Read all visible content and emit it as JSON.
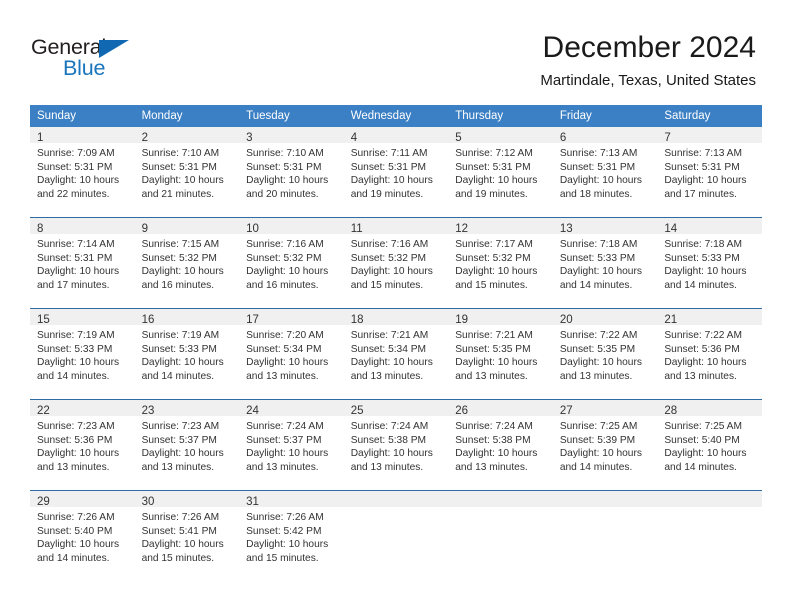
{
  "brand": {
    "name_part1": "General",
    "name_part2": "Blue",
    "accent_color": "#1b75bc",
    "triangle_color": "#1068b3"
  },
  "header": {
    "title": "December 2024",
    "subtitle": "Martindale, Texas, United States"
  },
  "calendar": {
    "header_bg": "#3b7fc4",
    "daynum_bg": "#f0f0f0",
    "separator_color": "#2e6da4",
    "weekday_headers": [
      "Sunday",
      "Monday",
      "Tuesday",
      "Wednesday",
      "Thursday",
      "Friday",
      "Saturday"
    ],
    "weeks": [
      [
        {
          "day": "1",
          "sunrise": "Sunrise: 7:09 AM",
          "sunset": "Sunset: 5:31 PM",
          "daylight1": "Daylight: 10 hours",
          "daylight2": "and 22 minutes."
        },
        {
          "day": "2",
          "sunrise": "Sunrise: 7:10 AM",
          "sunset": "Sunset: 5:31 PM",
          "daylight1": "Daylight: 10 hours",
          "daylight2": "and 21 minutes."
        },
        {
          "day": "3",
          "sunrise": "Sunrise: 7:10 AM",
          "sunset": "Sunset: 5:31 PM",
          "daylight1": "Daylight: 10 hours",
          "daylight2": "and 20 minutes."
        },
        {
          "day": "4",
          "sunrise": "Sunrise: 7:11 AM",
          "sunset": "Sunset: 5:31 PM",
          "daylight1": "Daylight: 10 hours",
          "daylight2": "and 19 minutes."
        },
        {
          "day": "5",
          "sunrise": "Sunrise: 7:12 AM",
          "sunset": "Sunset: 5:31 PM",
          "daylight1": "Daylight: 10 hours",
          "daylight2": "and 19 minutes."
        },
        {
          "day": "6",
          "sunrise": "Sunrise: 7:13 AM",
          "sunset": "Sunset: 5:31 PM",
          "daylight1": "Daylight: 10 hours",
          "daylight2": "and 18 minutes."
        },
        {
          "day": "7",
          "sunrise": "Sunrise: 7:13 AM",
          "sunset": "Sunset: 5:31 PM",
          "daylight1": "Daylight: 10 hours",
          "daylight2": "and 17 minutes."
        }
      ],
      [
        {
          "day": "8",
          "sunrise": "Sunrise: 7:14 AM",
          "sunset": "Sunset: 5:31 PM",
          "daylight1": "Daylight: 10 hours",
          "daylight2": "and 17 minutes."
        },
        {
          "day": "9",
          "sunrise": "Sunrise: 7:15 AM",
          "sunset": "Sunset: 5:32 PM",
          "daylight1": "Daylight: 10 hours",
          "daylight2": "and 16 minutes."
        },
        {
          "day": "10",
          "sunrise": "Sunrise: 7:16 AM",
          "sunset": "Sunset: 5:32 PM",
          "daylight1": "Daylight: 10 hours",
          "daylight2": "and 16 minutes."
        },
        {
          "day": "11",
          "sunrise": "Sunrise: 7:16 AM",
          "sunset": "Sunset: 5:32 PM",
          "daylight1": "Daylight: 10 hours",
          "daylight2": "and 15 minutes."
        },
        {
          "day": "12",
          "sunrise": "Sunrise: 7:17 AM",
          "sunset": "Sunset: 5:32 PM",
          "daylight1": "Daylight: 10 hours",
          "daylight2": "and 15 minutes."
        },
        {
          "day": "13",
          "sunrise": "Sunrise: 7:18 AM",
          "sunset": "Sunset: 5:33 PM",
          "daylight1": "Daylight: 10 hours",
          "daylight2": "and 14 minutes."
        },
        {
          "day": "14",
          "sunrise": "Sunrise: 7:18 AM",
          "sunset": "Sunset: 5:33 PM",
          "daylight1": "Daylight: 10 hours",
          "daylight2": "and 14 minutes."
        }
      ],
      [
        {
          "day": "15",
          "sunrise": "Sunrise: 7:19 AM",
          "sunset": "Sunset: 5:33 PM",
          "daylight1": "Daylight: 10 hours",
          "daylight2": "and 14 minutes."
        },
        {
          "day": "16",
          "sunrise": "Sunrise: 7:19 AM",
          "sunset": "Sunset: 5:33 PM",
          "daylight1": "Daylight: 10 hours",
          "daylight2": "and 14 minutes."
        },
        {
          "day": "17",
          "sunrise": "Sunrise: 7:20 AM",
          "sunset": "Sunset: 5:34 PM",
          "daylight1": "Daylight: 10 hours",
          "daylight2": "and 13 minutes."
        },
        {
          "day": "18",
          "sunrise": "Sunrise: 7:21 AM",
          "sunset": "Sunset: 5:34 PM",
          "daylight1": "Daylight: 10 hours",
          "daylight2": "and 13 minutes."
        },
        {
          "day": "19",
          "sunrise": "Sunrise: 7:21 AM",
          "sunset": "Sunset: 5:35 PM",
          "daylight1": "Daylight: 10 hours",
          "daylight2": "and 13 minutes."
        },
        {
          "day": "20",
          "sunrise": "Sunrise: 7:22 AM",
          "sunset": "Sunset: 5:35 PM",
          "daylight1": "Daylight: 10 hours",
          "daylight2": "and 13 minutes."
        },
        {
          "day": "21",
          "sunrise": "Sunrise: 7:22 AM",
          "sunset": "Sunset: 5:36 PM",
          "daylight1": "Daylight: 10 hours",
          "daylight2": "and 13 minutes."
        }
      ],
      [
        {
          "day": "22",
          "sunrise": "Sunrise: 7:23 AM",
          "sunset": "Sunset: 5:36 PM",
          "daylight1": "Daylight: 10 hours",
          "daylight2": "and 13 minutes."
        },
        {
          "day": "23",
          "sunrise": "Sunrise: 7:23 AM",
          "sunset": "Sunset: 5:37 PM",
          "daylight1": "Daylight: 10 hours",
          "daylight2": "and 13 minutes."
        },
        {
          "day": "24",
          "sunrise": "Sunrise: 7:24 AM",
          "sunset": "Sunset: 5:37 PM",
          "daylight1": "Daylight: 10 hours",
          "daylight2": "and 13 minutes."
        },
        {
          "day": "25",
          "sunrise": "Sunrise: 7:24 AM",
          "sunset": "Sunset: 5:38 PM",
          "daylight1": "Daylight: 10 hours",
          "daylight2": "and 13 minutes."
        },
        {
          "day": "26",
          "sunrise": "Sunrise: 7:24 AM",
          "sunset": "Sunset: 5:38 PM",
          "daylight1": "Daylight: 10 hours",
          "daylight2": "and 13 minutes."
        },
        {
          "day": "27",
          "sunrise": "Sunrise: 7:25 AM",
          "sunset": "Sunset: 5:39 PM",
          "daylight1": "Daylight: 10 hours",
          "daylight2": "and 14 minutes."
        },
        {
          "day": "28",
          "sunrise": "Sunrise: 7:25 AM",
          "sunset": "Sunset: 5:40 PM",
          "daylight1": "Daylight: 10 hours",
          "daylight2": "and 14 minutes."
        }
      ],
      [
        {
          "day": "29",
          "sunrise": "Sunrise: 7:26 AM",
          "sunset": "Sunset: 5:40 PM",
          "daylight1": "Daylight: 10 hours",
          "daylight2": "and 14 minutes."
        },
        {
          "day": "30",
          "sunrise": "Sunrise: 7:26 AM",
          "sunset": "Sunset: 5:41 PM",
          "daylight1": "Daylight: 10 hours",
          "daylight2": "and 15 minutes."
        },
        {
          "day": "31",
          "sunrise": "Sunrise: 7:26 AM",
          "sunset": "Sunset: 5:42 PM",
          "daylight1": "Daylight: 10 hours",
          "daylight2": "and 15 minutes."
        },
        {
          "day": "",
          "sunrise": "",
          "sunset": "",
          "daylight1": "",
          "daylight2": ""
        },
        {
          "day": "",
          "sunrise": "",
          "sunset": "",
          "daylight1": "",
          "daylight2": ""
        },
        {
          "day": "",
          "sunrise": "",
          "sunset": "",
          "daylight1": "",
          "daylight2": ""
        },
        {
          "day": "",
          "sunrise": "",
          "sunset": "",
          "daylight1": "",
          "daylight2": ""
        }
      ]
    ]
  }
}
